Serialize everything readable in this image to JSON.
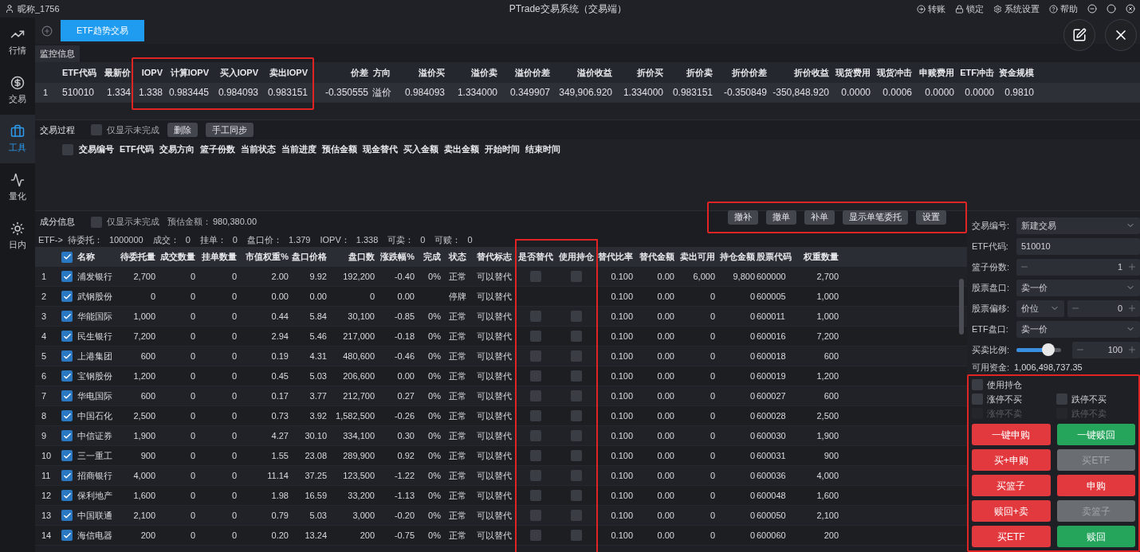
{
  "title_bar": {
    "user": "昵称_1756",
    "title": "PTrade交易系统（交易端）",
    "actions": [
      "转账",
      "锁定",
      "系统设置",
      "帮助"
    ]
  },
  "sidebar": [
    {
      "label": "行情",
      "selected": false
    },
    {
      "label": "交易",
      "selected": false
    },
    {
      "label": "工具",
      "selected": true
    },
    {
      "label": "量化",
      "selected": false
    },
    {
      "label": "日内",
      "selected": false
    }
  ],
  "tabs": [
    {
      "label": "ETF趋势交易",
      "selected": true
    }
  ],
  "monitor": {
    "title": "监控信息",
    "columns": [
      "ETF代码",
      "最新价",
      "IOPV",
      "计算IOPV",
      "买入IOPV",
      "卖出IOPV",
      "价差",
      "方向",
      "溢价买",
      "溢价卖",
      "溢价价差",
      "溢价收益",
      "折价买",
      "折价卖",
      "折价价差",
      "折价收益",
      "现货费用",
      "现货冲击",
      "申赎费用",
      "ETF冲击",
      "资金规模"
    ],
    "rows": [
      {
        "index": "1",
        "cells": [
          "510010",
          "1.334",
          "1.338",
          "0.983445",
          "0.984093",
          "0.983151",
          "-0.350555",
          "溢价",
          "0.984093",
          "1.334000",
          "0.349907",
          "349,906.920",
          "1.334000",
          "0.983151",
          "-0.350849",
          "-350,848.920",
          "0.0000",
          "0.0006",
          "0.0000",
          "0.0000",
          "0.9810"
        ]
      }
    ]
  },
  "process": {
    "title": "交易过程",
    "filter": {
      "label": "仅显示未完成",
      "checked": false
    },
    "buttons": [
      "删除",
      "手工同步"
    ],
    "select_all": false,
    "columns": [
      "交易编号",
      "ETF代码",
      "交易方向",
      "篮子份数",
      "当前状态",
      "当前进度",
      "预估金额",
      "现金替代",
      "买入金额",
      "卖出金额",
      "开始时间",
      "结束时间"
    ]
  },
  "components": {
    "title": "成分信息",
    "filter": {
      "label": "仅显示未完成",
      "checked": false
    },
    "estimate": {
      "label": "预估金额：",
      "value": "980,380.00"
    },
    "buttons": [
      "撤补",
      "撤单",
      "补单",
      "显示单笔委托",
      "设置"
    ],
    "summary_lead": "ETF->",
    "summary": [
      {
        "label": "待委托：",
        "value": "1000000"
      },
      {
        "label": "成交：",
        "value": "0"
      },
      {
        "label": "挂单：",
        "value": "0"
      },
      {
        "label": "盘口价：",
        "value": "1.379"
      },
      {
        "label": "IOPV：",
        "value": "1.338"
      },
      {
        "label": "可卖：",
        "value": "0"
      },
      {
        "label": "可赎：",
        "value": "0"
      }
    ],
    "select_all": true,
    "columns": [
      {
        "label": "名称",
        "kind": "text"
      },
      {
        "label": "待委托量",
        "kind": "text"
      },
      {
        "label": "成交数量",
        "kind": "text"
      },
      {
        "label": "挂单数量",
        "kind": "text"
      },
      {
        "label": "市值权重%",
        "kind": "text"
      },
      {
        "label": "盘口价格",
        "kind": "text"
      },
      {
        "label": "盘口数",
        "kind": "text"
      },
      {
        "label": "涨跌幅%",
        "kind": "text"
      },
      {
        "label": "完成",
        "kind": "text"
      },
      {
        "label": "状态",
        "kind": "text"
      },
      {
        "label": "替代标志",
        "kind": "text"
      },
      {
        "label": "是否替代",
        "kind": "check"
      },
      {
        "label": "使用持仓",
        "kind": "check"
      },
      {
        "label": "替代比率",
        "kind": "text"
      },
      {
        "label": "替代金额",
        "kind": "text"
      },
      {
        "label": "卖出可用",
        "kind": "text"
      },
      {
        "label": "持仓金额",
        "kind": "text"
      },
      {
        "label": "股票代码",
        "kind": "text"
      },
      {
        "label": "权重数量",
        "kind": "text"
      }
    ],
    "rows": [
      {
        "index": "1",
        "checked": true,
        "cells": [
          "浦发银行",
          "2,700",
          "0",
          "0",
          "2.00",
          "9.92",
          "192,200",
          "-0.40",
          "0%",
          "正常",
          "可以替代",
          false,
          false,
          "0.100",
          "0.00",
          "6,000",
          "9,800",
          "600000",
          "2,700"
        ]
      },
      {
        "index": "2",
        "checked": true,
        "cells": [
          "武钢股份",
          "0",
          "0",
          "0",
          "0.00",
          "0.00",
          "0",
          "0.00",
          null,
          "停牌",
          "可以替代",
          null,
          null,
          "0.100",
          "0.00",
          "0",
          "0",
          "600005",
          "1,000"
        ]
      },
      {
        "index": "3",
        "checked": true,
        "cells": [
          "华能国际",
          "1,000",
          "0",
          "0",
          "0.44",
          "5.84",
          "30,100",
          "-0.85",
          "0%",
          "正常",
          "可以替代",
          false,
          false,
          "0.100",
          "0.00",
          "0",
          "0",
          "600011",
          "1,000"
        ]
      },
      {
        "index": "4",
        "checked": true,
        "cells": [
          "民生银行",
          "7,200",
          "0",
          "0",
          "2.94",
          "5.46",
          "217,000",
          "-0.18",
          "0%",
          "正常",
          "可以替代",
          false,
          false,
          "0.100",
          "0.00",
          "0",
          "0",
          "600016",
          "7,200"
        ]
      },
      {
        "index": "5",
        "checked": true,
        "cells": [
          "上港集团",
          "600",
          "0",
          "0",
          "0.19",
          "4.31",
          "480,600",
          "-0.46",
          "0%",
          "正常",
          "可以替代",
          false,
          false,
          "0.100",
          "0.00",
          "0",
          "0",
          "600018",
          "600"
        ]
      },
      {
        "index": "6",
        "checked": true,
        "cells": [
          "宝钢股份",
          "1,200",
          "0",
          "0",
          "0.45",
          "5.03",
          "206,600",
          "0.00",
          "0%",
          "正常",
          "可以替代",
          false,
          false,
          "0.100",
          "0.00",
          "0",
          "0",
          "600019",
          "1,200"
        ]
      },
      {
        "index": "7",
        "checked": true,
        "cells": [
          "华电国际",
          "600",
          "0",
          "0",
          "0.17",
          "3.77",
          "212,700",
          "0.27",
          "0%",
          "正常",
          "可以替代",
          false,
          false,
          "0.100",
          "0.00",
          "0",
          "0",
          "600027",
          "600"
        ]
      },
      {
        "index": "8",
        "checked": true,
        "cells": [
          "中国石化",
          "2,500",
          "0",
          "0",
          "0.73",
          "3.92",
          "1,582,500",
          "-0.26",
          "0%",
          "正常",
          "可以替代",
          false,
          false,
          "0.100",
          "0.00",
          "0",
          "0",
          "600028",
          "2,500"
        ]
      },
      {
        "index": "9",
        "checked": true,
        "cells": [
          "中信证券",
          "1,900",
          "0",
          "0",
          "4.27",
          "30.10",
          "334,100",
          "0.30",
          "0%",
          "正常",
          "可以替代",
          false,
          false,
          "0.100",
          "0.00",
          "0",
          "0",
          "600030",
          "1,900"
        ]
      },
      {
        "index": "10",
        "checked": true,
        "cells": [
          "三一重工",
          "900",
          "0",
          "0",
          "1.55",
          "23.08",
          "289,900",
          "0.92",
          "0%",
          "正常",
          "可以替代",
          false,
          false,
          "0.100",
          "0.00",
          "0",
          "0",
          "600031",
          "900"
        ]
      },
      {
        "index": "11",
        "checked": true,
        "cells": [
          "招商银行",
          "4,000",
          "0",
          "0",
          "11.14",
          "37.25",
          "123,500",
          "-1.22",
          "0%",
          "正常",
          "可以替代",
          false,
          false,
          "0.100",
          "0.00",
          "0",
          "0",
          "600036",
          "4,000"
        ]
      },
      {
        "index": "12",
        "checked": true,
        "cells": [
          "保利地产",
          "1,600",
          "0",
          "0",
          "1.98",
          "16.59",
          "33,200",
          "-1.13",
          "0%",
          "正常",
          "可以替代",
          false,
          false,
          "0.100",
          "0.00",
          "0",
          "0",
          "600048",
          "1,600"
        ]
      },
      {
        "index": "13",
        "checked": true,
        "cells": [
          "中国联通",
          "2,100",
          "0",
          "0",
          "0.79",
          "5.03",
          "3,000",
          "-0.20",
          "0%",
          "正常",
          "可以替代",
          false,
          false,
          "0.100",
          "0.00",
          "0",
          "0",
          "600050",
          "2,100"
        ]
      },
      {
        "index": "14",
        "checked": true,
        "cells": [
          "海信电器",
          "200",
          "0",
          "0",
          "0.20",
          "13.24",
          "200",
          "-0.75",
          "0%",
          "正常",
          "可以替代",
          false,
          false,
          "0.100",
          "0.00",
          "0",
          "0",
          "600060",
          "200"
        ]
      }
    ]
  },
  "order_form": {
    "fields": [
      {
        "kind": "select",
        "label": "交易编号:",
        "value": "新建交易"
      },
      {
        "kind": "input",
        "label": "ETF代码:",
        "value": "510010"
      },
      {
        "kind": "stepper",
        "label": "篮子份数:",
        "value": "1"
      },
      {
        "kind": "select",
        "label": "股票盘口:",
        "value": "卖一价"
      },
      {
        "kind": "select_stepper",
        "label": "股票偏移:",
        "value": "价位",
        "amount": "0"
      },
      {
        "kind": "select",
        "label": "ETF盘口:",
        "value": "卖一价"
      },
      {
        "kind": "slider",
        "label": "买卖比例:",
        "level": 0.72,
        "amount": "100"
      }
    ],
    "funds": {
      "label": "可用资金:",
      "value": "1,006,498,737.35"
    },
    "options": [
      {
        "label": "使用持仓",
        "checked": false,
        "disabled": false
      },
      {
        "label": "涨停不买",
        "checked": false,
        "disabled": false
      },
      {
        "label": "跌停不买",
        "checked": false,
        "disabled": false
      },
      {
        "label": "涨停不卖",
        "checked": false,
        "disabled": true
      },
      {
        "label": "跌停不卖",
        "checked": false,
        "disabled": true
      }
    ],
    "buttons": [
      {
        "label": "一键申购",
        "color": "#e2393f",
        "disabled": false
      },
      {
        "label": "一键赎回",
        "color": "#25a55c",
        "disabled": false
      },
      {
        "label": "买+申购",
        "color": "#e2393f",
        "disabled": false
      },
      {
        "label": "买ETF",
        "color": "#6a6d72",
        "disabled": true
      },
      {
        "label": "买篮子",
        "color": "#e2393f",
        "disabled": false
      },
      {
        "label": "申购",
        "color": "#e2393f",
        "disabled": false
      },
      {
        "label": "赎回+卖",
        "color": "#e2393f",
        "disabled": false
      },
      {
        "label": "卖篮子",
        "color": "#6a6d72",
        "disabled": true
      },
      {
        "label": "买ETF",
        "color": "#e2393f",
        "disabled": false
      },
      {
        "label": "赎回",
        "color": "#25a55c",
        "disabled": false
      }
    ]
  }
}
